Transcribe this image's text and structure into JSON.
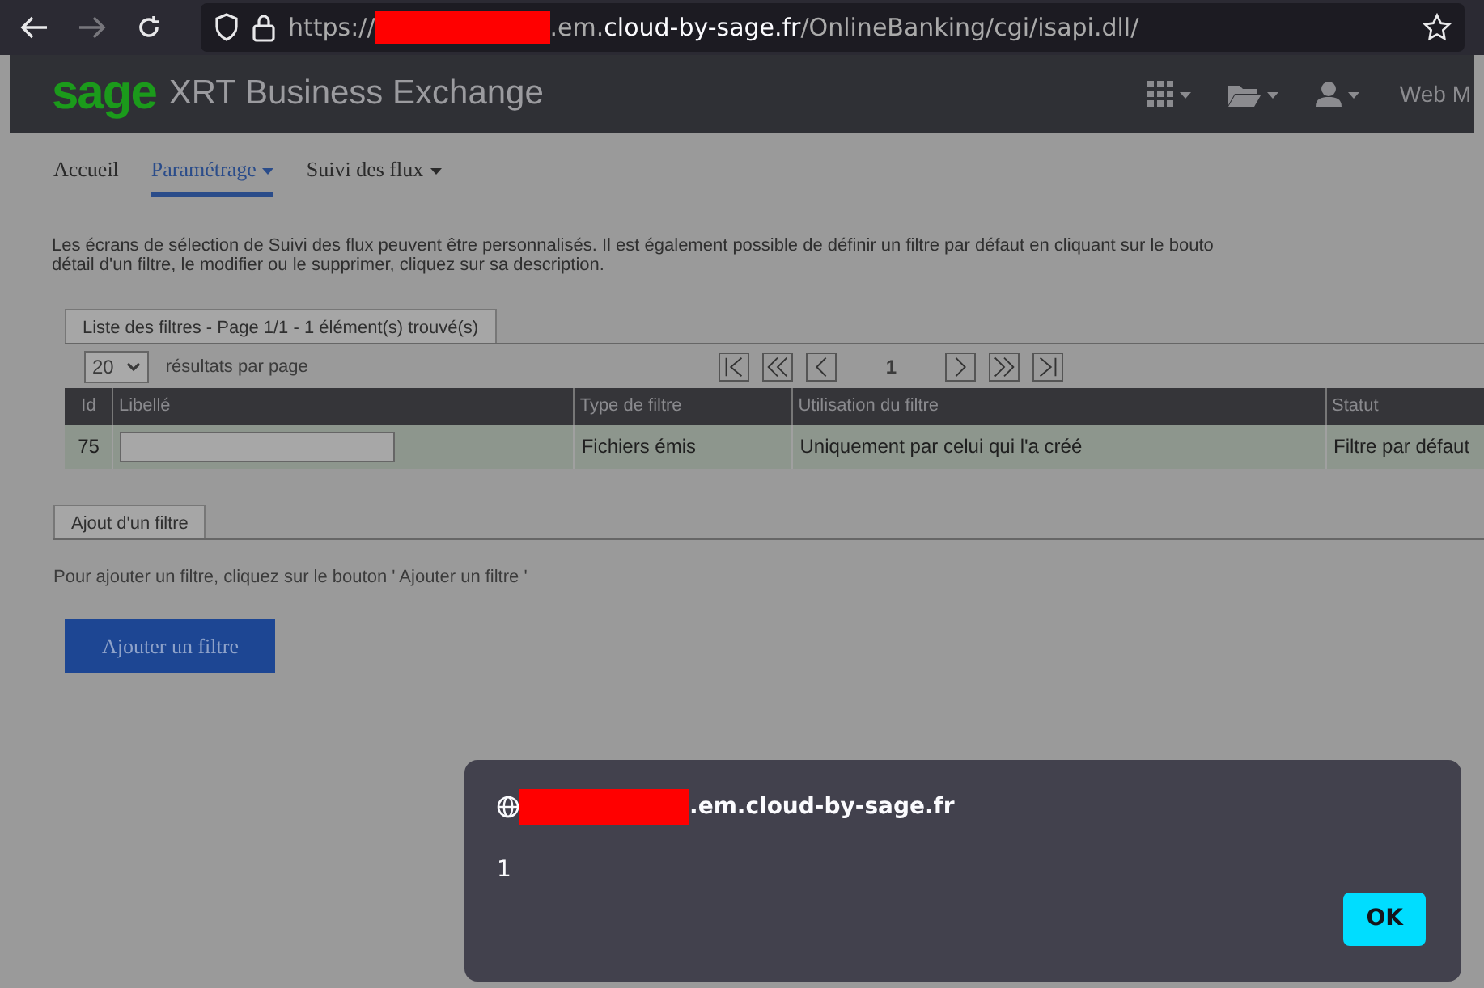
{
  "browser": {
    "back_enabled": true,
    "forward_enabled": false,
    "url_scheme": "https://",
    "url_host": ".em.**cloud-by-sage.fr**",
    "url_path": "/OnlineBanking/cgi/isapi.dll/"
  },
  "app_header": {
    "logo": "sage",
    "title": "XRT Business Exchange",
    "menus": [
      {
        "kind": "grid"
      },
      {
        "kind": "folder"
      },
      {
        "kind": "user"
      }
    ],
    "user_label": "Web M"
  },
  "nav": [
    {
      "label": "Accueil",
      "dropdown": false,
      "selected": false
    },
    {
      "label": "Paramétrage",
      "dropdown": true,
      "selected": true
    },
    {
      "label": "Suivi des flux",
      "dropdown": true,
      "selected": false
    }
  ],
  "intro": "Les écrans de sélection de Suivi des flux peuvent être personnalisés. Il est également possible de définir un filtre par défaut en cliquant sur le bouto\ndétail d'un filtre, le modifier ou le supprimer, cliquez sur sa description.",
  "filter_list": {
    "tab": "Liste des filtres - Page 1/1 - 1 élément(s) trouvé(s)",
    "page_size": "20",
    "page_size_label": "résultats par page",
    "pagination": {
      "current": "1"
    },
    "table": {
      "columns": [
        "Id",
        "Libellé",
        "Type de filtre",
        "Utilisation du filtre",
        "Statut"
      ],
      "rows": [
        {
          "id": "75",
          "type": "Fichiers émis",
          "usage": "Uniquement par celui qui l'a créé",
          "status": "Filtre par défaut"
        }
      ]
    }
  },
  "add_filter": {
    "tab": "Ajout d'un filtre",
    "text": "Pour ajouter un filtre, cliquez sur le bouton ' Ajouter un filtre '",
    "button": "Ajouter un filtre"
  },
  "alert": {
    "host": ".em.cloud-by-sage.fr",
    "message": "1",
    "button": "OK"
  }
}
